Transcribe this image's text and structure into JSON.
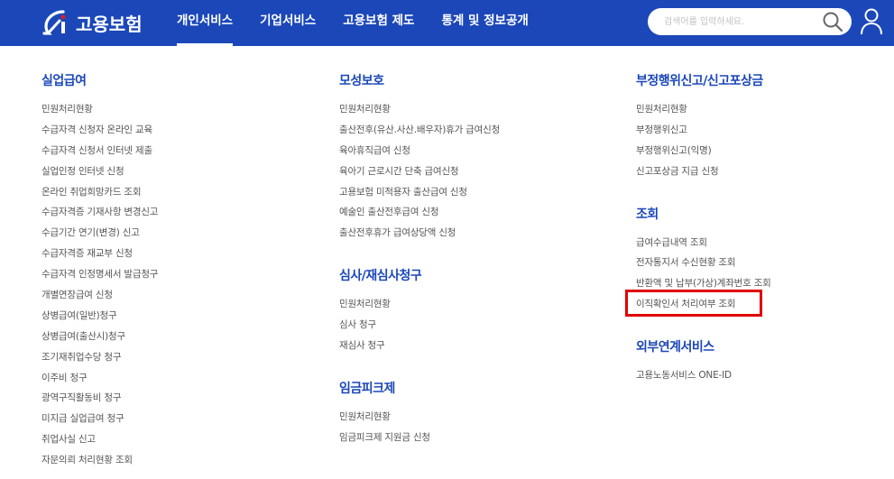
{
  "header": {
    "logo_text": "고용보험",
    "nav": [
      "개인서비스",
      "기업서비스",
      "고용보험 제도",
      "통계 및 정보공개"
    ],
    "search_placeholder": "검색어를 입력하세요."
  },
  "columns": {
    "c1": {
      "s1": {
        "title": "실업급여",
        "items": [
          "민원처리현황",
          "수급자격 신청자 온라인 교육",
          "수급자격 신청서 인터넷 제출",
          "실업인정 인터넷 신청",
          "온라인 취업희망카드 조회",
          "수급자격증 기재사항 변경신고",
          "수급기간 연기(변경) 신고",
          "수급자격증 재교부 신청",
          "수급자격 인정명세서 발급청구",
          "개별연장급여 신청",
          "상병급여(일반)청구",
          "상병급여(출산시)청구",
          "조기재취업수당 청구",
          "이주비 청구",
          "광역구직활동비 청구",
          "미지급 실업급여 청구",
          "취업사실 신고",
          "자문의뢰 처리현황 조회"
        ]
      }
    },
    "c2": {
      "s1": {
        "title": "모성보호",
        "items": [
          "민원처리현황",
          "출산전후(유산.사산.배우자)휴가 급여신청",
          "육아휴직급여 신청",
          "육아기 근로시간 단축 급여신청",
          "고용보험 미적용자 출산급여 신청",
          "예술인 출산전후급여 신청",
          "출산전후휴가 급여상당액 신청"
        ]
      },
      "s2": {
        "title": "심사/재심사청구",
        "items": [
          "민원처리현황",
          "심사 청구",
          "재심사 청구"
        ]
      },
      "s3": {
        "title": "임금피크제",
        "items": [
          "민원처리현황",
          "임금피크제 지원금 신청"
        ]
      }
    },
    "c3": {
      "s1": {
        "title": "부정행위신고/신고포상금",
        "items": [
          "민원처리현황",
          "부정행위신고",
          "부정행위신고(익명)",
          "신고포상금 지급 신청"
        ]
      },
      "s2": {
        "title": "조회",
        "items": [
          "급여수급내역 조회",
          "전자통지서 수신현황 조회",
          "반환액 및 납부(가상)계좌번호 조회",
          "이직확인서 처리여부 조회"
        ]
      },
      "s3": {
        "title": "외부연계서비스",
        "items": [
          "고용노동서비스 ONE-ID"
        ]
      }
    }
  },
  "colors": {
    "header_bg": "#1b47b9",
    "section_title": "#1b47b9",
    "highlight": "#e00000"
  }
}
